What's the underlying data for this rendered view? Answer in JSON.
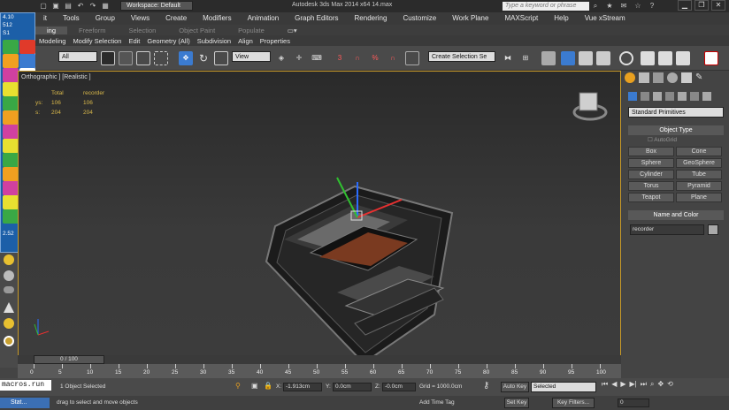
{
  "titlebar": {
    "workspace": "Workspace: Default",
    "app_title": "Autodesk 3ds Max  2014 x64     14.max",
    "search_placeholder": "Type a keyword or phrase",
    "win_min": "▁",
    "win_restore": "❐",
    "win_close": "✕"
  },
  "menu": [
    "it",
    "Tools",
    "Group",
    "Views",
    "Create",
    "Modifiers",
    "Animation",
    "Graph Editors",
    "Rendering",
    "Customize",
    "Work Plane",
    "MAXScript",
    "Help",
    "Vue xStream"
  ],
  "ribbon_tabs": [
    "ing",
    "Freeform",
    "Selection",
    "Object Paint",
    "Populate"
  ],
  "ribbon_sub": [
    "Modeling",
    "Modify Selection",
    "Edit",
    "Geometry (All)",
    "Subdivision",
    "Align",
    "Properties"
  ],
  "toolbar": {
    "filter": "All",
    "refcoord": "View",
    "named_sel": "Create Selection Se"
  },
  "leftpanel": {
    "top_values": [
      "4.10",
      "512",
      "S1"
    ],
    "bottom_values": [
      "2.52"
    ]
  },
  "viewport": {
    "label": "Orthographic ] [Realistic ]",
    "stats_header": [
      "Total",
      "recorder"
    ],
    "stats_rows": [
      {
        "label": "ys:",
        "total": "106",
        "obj": "106"
      },
      {
        "label": "s:",
        "total": "204",
        "obj": "204"
      }
    ]
  },
  "cmdpanel": {
    "category": "Standard Primitives",
    "object_type_title": "Object Type",
    "autogrid": "AutoGrid",
    "buttons": [
      "Box",
      "Cone",
      "Sphere",
      "GeoSphere",
      "Cylinder",
      "Tube",
      "Torus",
      "Pyramid",
      "Teapot",
      "Plane"
    ],
    "name_color_title": "Name and Color",
    "object_name": "recorder",
    "object_color": "#aaaaaa"
  },
  "timeline": {
    "frame_label": "0 / 100",
    "ticks": [
      "0",
      "5",
      "10",
      "15",
      "20",
      "25",
      "30",
      "35",
      "40",
      "45",
      "50",
      "55",
      "60",
      "65",
      "70",
      "75",
      "80",
      "85",
      "90",
      "95",
      "100"
    ]
  },
  "status": {
    "site": "macros.run",
    "selected": "1 Object Selected",
    "x_label": "X:",
    "x": "-1.913cm",
    "y_label": "Y:",
    "y": "0.0cm",
    "z_label": "Z:",
    "z": "-0.0cm",
    "grid": "Grid = 1000.0cm",
    "autokey": "Auto Key",
    "setkey": "Set Key",
    "keymode": "Selected",
    "keyfilters": "Key Filters...",
    "prompt": "drag to select and move objects",
    "add_time_tag": "Add Time Tag",
    "frame": "0",
    "start": "Stat..."
  }
}
